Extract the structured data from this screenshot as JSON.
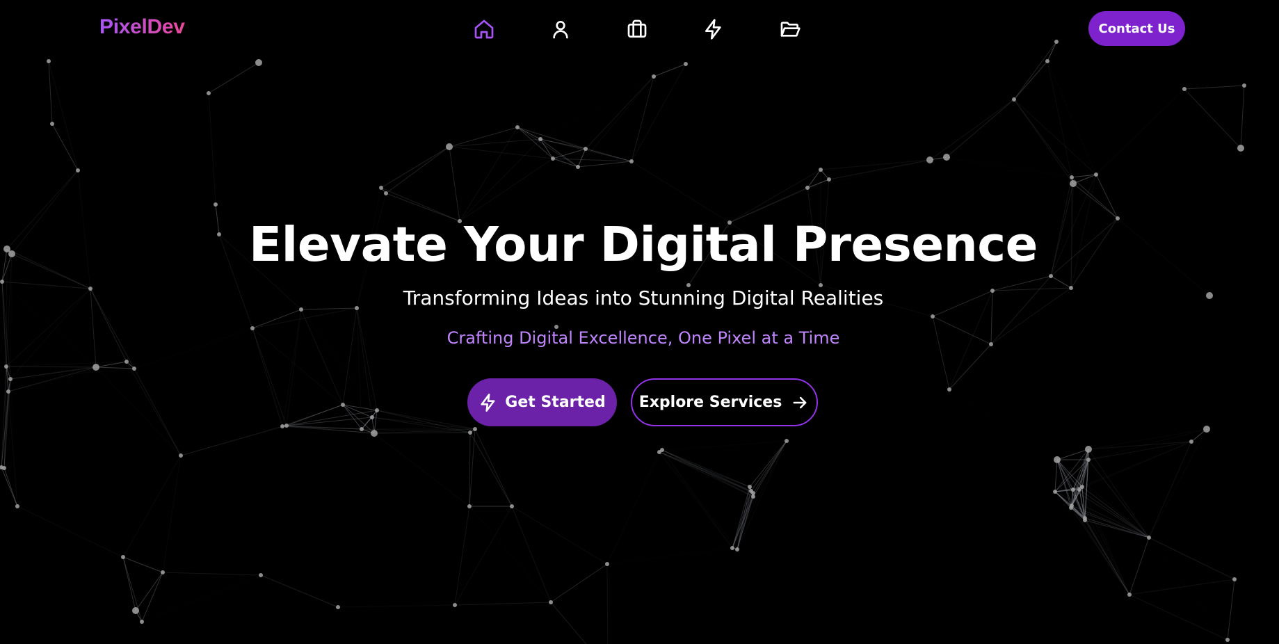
{
  "brand": {
    "logo_text": "PixelDev",
    "gradient_start": "#a855f7",
    "gradient_end": "#ec4899"
  },
  "nav": {
    "items": [
      {
        "icon": "home-icon",
        "active": true
      },
      {
        "icon": "user-icon",
        "active": false
      },
      {
        "icon": "briefcase-icon",
        "active": false
      },
      {
        "icon": "lightning-icon",
        "active": false
      },
      {
        "icon": "folder-open-icon",
        "active": false
      }
    ],
    "active_color": "#a855f7",
    "contact_label": "Contact Us",
    "contact_color": "#7e22ce"
  },
  "hero": {
    "title": "Elevate Your Digital Presence",
    "subtitle": "Transforming Ideas into Stunning Digital Realities",
    "tagline": "Crafting Digital Excellence, One Pixel at a Time",
    "tagline_color": "#c084fc",
    "primary_button": {
      "label": "Get Started",
      "icon": "lightning-icon",
      "color": "#6b21a8"
    },
    "secondary_button": {
      "label": "Explore Services",
      "icon": "arrow-right-icon",
      "border_color": "#9333ea"
    }
  },
  "background": {
    "style": "particle-network",
    "node_color": "#9ca3af",
    "line_color": "#6b7280"
  }
}
